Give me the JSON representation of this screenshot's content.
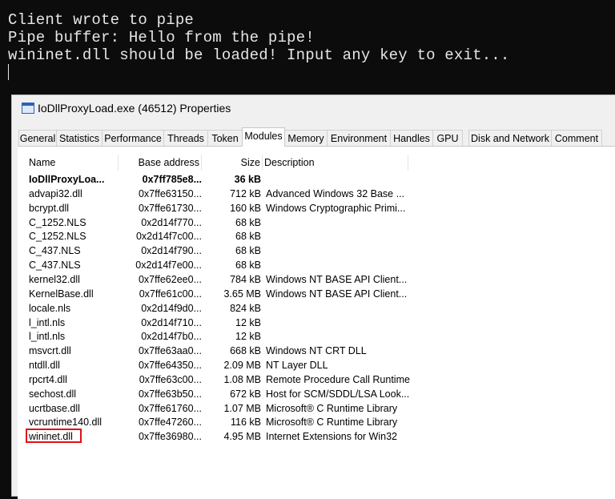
{
  "console": {
    "lines": [
      "Client wrote to pipe",
      "Pipe buffer: Hello from the pipe!",
      "wininet.dll should be loaded! Input any key to exit..."
    ]
  },
  "window": {
    "title": "IoDllProxyLoad.exe (46512) Properties",
    "tabs": [
      "General",
      "Statistics",
      "Performance",
      "Threads",
      "Token",
      "Modules",
      "Memory",
      "Environment",
      "Handles",
      "GPU",
      "Disk and Network",
      "Comment"
    ],
    "active_tab": "Modules"
  },
  "modules": {
    "columns": [
      "Name",
      "Base address",
      "Size",
      "Description"
    ],
    "rows": [
      {
        "name": "IoDllProxyLoa...",
        "base": "0x7ff785e8...",
        "size": "36 kB",
        "desc": ""
      },
      {
        "name": "advapi32.dll",
        "base": "0x7ffe63150...",
        "size": "712 kB",
        "desc": "Advanced Windows 32 Base ..."
      },
      {
        "name": "bcrypt.dll",
        "base": "0x7ffe61730...",
        "size": "160 kB",
        "desc": "Windows Cryptographic Primi..."
      },
      {
        "name": "C_1252.NLS",
        "base": "0x2d14f770...",
        "size": "68 kB",
        "desc": ""
      },
      {
        "name": "C_1252.NLS",
        "base": "0x2d14f7c00...",
        "size": "68 kB",
        "desc": ""
      },
      {
        "name": "C_437.NLS",
        "base": "0x2d14f790...",
        "size": "68 kB",
        "desc": ""
      },
      {
        "name": "C_437.NLS",
        "base": "0x2d14f7e00...",
        "size": "68 kB",
        "desc": ""
      },
      {
        "name": "kernel32.dll",
        "base": "0x7ffe62ee0...",
        "size": "784 kB",
        "desc": "Windows NT BASE API Client..."
      },
      {
        "name": "KernelBase.dll",
        "base": "0x7ffe61c00...",
        "size": "3.65 MB",
        "desc": "Windows NT BASE API Client..."
      },
      {
        "name": "locale.nls",
        "base": "0x2d14f9d0...",
        "size": "824 kB",
        "desc": ""
      },
      {
        "name": "l_intl.nls",
        "base": "0x2d14f710...",
        "size": "12 kB",
        "desc": ""
      },
      {
        "name": "l_intl.nls",
        "base": "0x2d14f7b0...",
        "size": "12 kB",
        "desc": ""
      },
      {
        "name": "msvcrt.dll",
        "base": "0x7ffe63aa0...",
        "size": "668 kB",
        "desc": "Windows NT CRT DLL"
      },
      {
        "name": "ntdll.dll",
        "base": "0x7ffe64350...",
        "size": "2.09 MB",
        "desc": "NT Layer DLL"
      },
      {
        "name": "rpcrt4.dll",
        "base": "0x7ffe63c00...",
        "size": "1.08 MB",
        "desc": "Remote Procedure Call Runtime"
      },
      {
        "name": "sechost.dll",
        "base": "0x7ffe63b50...",
        "size": "672 kB",
        "desc": "Host for SCM/SDDL/LSA Look..."
      },
      {
        "name": "ucrtbase.dll",
        "base": "0x7ffe61760...",
        "size": "1.07 MB",
        "desc": "Microsoft® C Runtime Library"
      },
      {
        "name": "vcruntime140.dll",
        "base": "0x7ffe47260...",
        "size": "116 kB",
        "desc": "Microsoft® C Runtime Library"
      },
      {
        "name": "wininet.dll",
        "base": "0x7ffe36980...",
        "size": "4.95 MB",
        "desc": "Internet Extensions for Win32"
      }
    ]
  },
  "colors": {
    "highlight": "#e0101a",
    "console_bg": "#0c0c0c",
    "console_text": "#e6e6e6"
  },
  "icons": {
    "app": "app-window-icon"
  }
}
